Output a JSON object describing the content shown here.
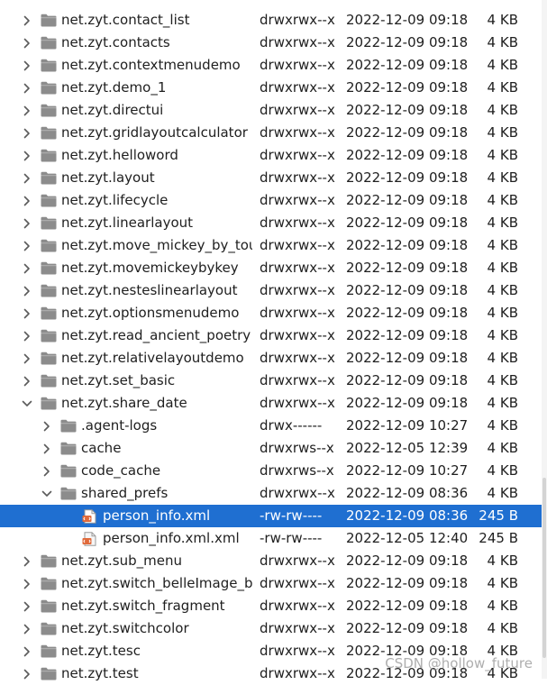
{
  "colors": {
    "selection": "#1f6fd1",
    "folder": "#8c8c8c",
    "file_accent": "#e06a3b",
    "text": "#202020"
  },
  "icons": {
    "expanded": "chevron-down-icon",
    "collapsed": "chevron-right-icon",
    "folder": "folder-icon",
    "file": "xml-file-icon"
  },
  "rows": [
    {
      "name": "net.zyt.contact_list",
      "perm": "drwxrwx--x",
      "date": "2022-12-09 09:18",
      "size": "4 KB",
      "level": 0,
      "type": "folder",
      "state": "collapsed"
    },
    {
      "name": "net.zyt.contacts",
      "perm": "drwxrwx--x",
      "date": "2022-12-09 09:18",
      "size": "4 KB",
      "level": 0,
      "type": "folder",
      "state": "collapsed"
    },
    {
      "name": "net.zyt.contextmenudemo",
      "perm": "drwxrwx--x",
      "date": "2022-12-09 09:18",
      "size": "4 KB",
      "level": 0,
      "type": "folder",
      "state": "collapsed"
    },
    {
      "name": "net.zyt.demo_1",
      "perm": "drwxrwx--x",
      "date": "2022-12-09 09:18",
      "size": "4 KB",
      "level": 0,
      "type": "folder",
      "state": "collapsed"
    },
    {
      "name": "net.zyt.directui",
      "perm": "drwxrwx--x",
      "date": "2022-12-09 09:18",
      "size": "4 KB",
      "level": 0,
      "type": "folder",
      "state": "collapsed"
    },
    {
      "name": "net.zyt.gridlayoutcalculator",
      "perm": "drwxrwx--x",
      "date": "2022-12-09 09:18",
      "size": "4 KB",
      "level": 0,
      "type": "folder",
      "state": "collapsed"
    },
    {
      "name": "net.zyt.helloword",
      "perm": "drwxrwx--x",
      "date": "2022-12-09 09:18",
      "size": "4 KB",
      "level": 0,
      "type": "folder",
      "state": "collapsed"
    },
    {
      "name": "net.zyt.layout",
      "perm": "drwxrwx--x",
      "date": "2022-12-09 09:18",
      "size": "4 KB",
      "level": 0,
      "type": "folder",
      "state": "collapsed"
    },
    {
      "name": "net.zyt.lifecycle",
      "perm": "drwxrwx--x",
      "date": "2022-12-09 09:18",
      "size": "4 KB",
      "level": 0,
      "type": "folder",
      "state": "collapsed"
    },
    {
      "name": "net.zyt.linearlayout",
      "perm": "drwxrwx--x",
      "date": "2022-12-09 09:18",
      "size": "4 KB",
      "level": 0,
      "type": "folder",
      "state": "collapsed"
    },
    {
      "name": "net.zyt.move_mickey_by_tou",
      "perm": "drwxrwx--x",
      "date": "2022-12-09 09:18",
      "size": "4 KB",
      "level": 0,
      "type": "folder",
      "state": "collapsed"
    },
    {
      "name": "net.zyt.movemickeybykey",
      "perm": "drwxrwx--x",
      "date": "2022-12-09 09:18",
      "size": "4 KB",
      "level": 0,
      "type": "folder",
      "state": "collapsed"
    },
    {
      "name": "net.zyt.nesteslinearlayout",
      "perm": "drwxrwx--x",
      "date": "2022-12-09 09:18",
      "size": "4 KB",
      "level": 0,
      "type": "folder",
      "state": "collapsed"
    },
    {
      "name": "net.zyt.optionsmenudemo",
      "perm": "drwxrwx--x",
      "date": "2022-12-09 09:18",
      "size": "4 KB",
      "level": 0,
      "type": "folder",
      "state": "collapsed"
    },
    {
      "name": "net.zyt.read_ancient_poetry",
      "perm": "drwxrwx--x",
      "date": "2022-12-09 09:18",
      "size": "4 KB",
      "level": 0,
      "type": "folder",
      "state": "collapsed"
    },
    {
      "name": "net.zyt.relativelayoutdemo",
      "perm": "drwxrwx--x",
      "date": "2022-12-09 09:18",
      "size": "4 KB",
      "level": 0,
      "type": "folder",
      "state": "collapsed"
    },
    {
      "name": "net.zyt.set_basic",
      "perm": "drwxrwx--x",
      "date": "2022-12-09 09:18",
      "size": "4 KB",
      "level": 0,
      "type": "folder",
      "state": "collapsed"
    },
    {
      "name": "net.zyt.share_date",
      "perm": "drwxrwx--x",
      "date": "2022-12-09 09:18",
      "size": "4 KB",
      "level": 0,
      "type": "folder",
      "state": "expanded"
    },
    {
      "name": ".agent-logs",
      "perm": "drwx------",
      "date": "2022-12-09 10:27",
      "size": "4 KB",
      "level": 1,
      "type": "folder",
      "state": "collapsed"
    },
    {
      "name": "cache",
      "perm": "drwxrws--x",
      "date": "2022-12-05 12:39",
      "size": "4 KB",
      "level": 1,
      "type": "folder",
      "state": "collapsed"
    },
    {
      "name": "code_cache",
      "perm": "drwxrws--x",
      "date": "2022-12-09 10:27",
      "size": "4 KB",
      "level": 1,
      "type": "folder",
      "state": "collapsed"
    },
    {
      "name": "shared_prefs",
      "perm": "drwxrwx--x",
      "date": "2022-12-09 08:36",
      "size": "4 KB",
      "level": 1,
      "type": "folder",
      "state": "expanded"
    },
    {
      "name": "person_info.xml",
      "perm": "-rw-rw----",
      "date": "2022-12-09 08:36",
      "size": "245 B",
      "level": 2,
      "type": "file",
      "state": "none",
      "selected": true
    },
    {
      "name": "person_info.xml.xml",
      "perm": "-rw-rw----",
      "date": "2022-12-05 12:40",
      "size": "245 B",
      "level": 2,
      "type": "file",
      "state": "none"
    },
    {
      "name": "net.zyt.sub_menu",
      "perm": "drwxrwx--x",
      "date": "2022-12-09 09:18",
      "size": "4 KB",
      "level": 0,
      "type": "folder",
      "state": "collapsed"
    },
    {
      "name": "net.zyt.switch_belleImage_by",
      "perm": "drwxrwx--x",
      "date": "2022-12-09 09:18",
      "size": "4 KB",
      "level": 0,
      "type": "folder",
      "state": "collapsed"
    },
    {
      "name": "net.zyt.switch_fragment",
      "perm": "drwxrwx--x",
      "date": "2022-12-09 09:18",
      "size": "4 KB",
      "level": 0,
      "type": "folder",
      "state": "collapsed"
    },
    {
      "name": "net.zyt.switchcolor",
      "perm": "drwxrwx--x",
      "date": "2022-12-09 09:18",
      "size": "4 KB",
      "level": 0,
      "type": "folder",
      "state": "collapsed"
    },
    {
      "name": "net.zyt.tesc",
      "perm": "drwxrwx--x",
      "date": "2022-12-09 09:18",
      "size": "4 KB",
      "level": 0,
      "type": "folder",
      "state": "collapsed"
    },
    {
      "name": "net.zyt.test",
      "perm": "drwxrwx--x",
      "date": "2022-12-09 09:18",
      "size": "4 KB",
      "level": 0,
      "type": "folder",
      "state": "collapsed"
    }
  ],
  "watermark": "CSDN @hollow_future"
}
